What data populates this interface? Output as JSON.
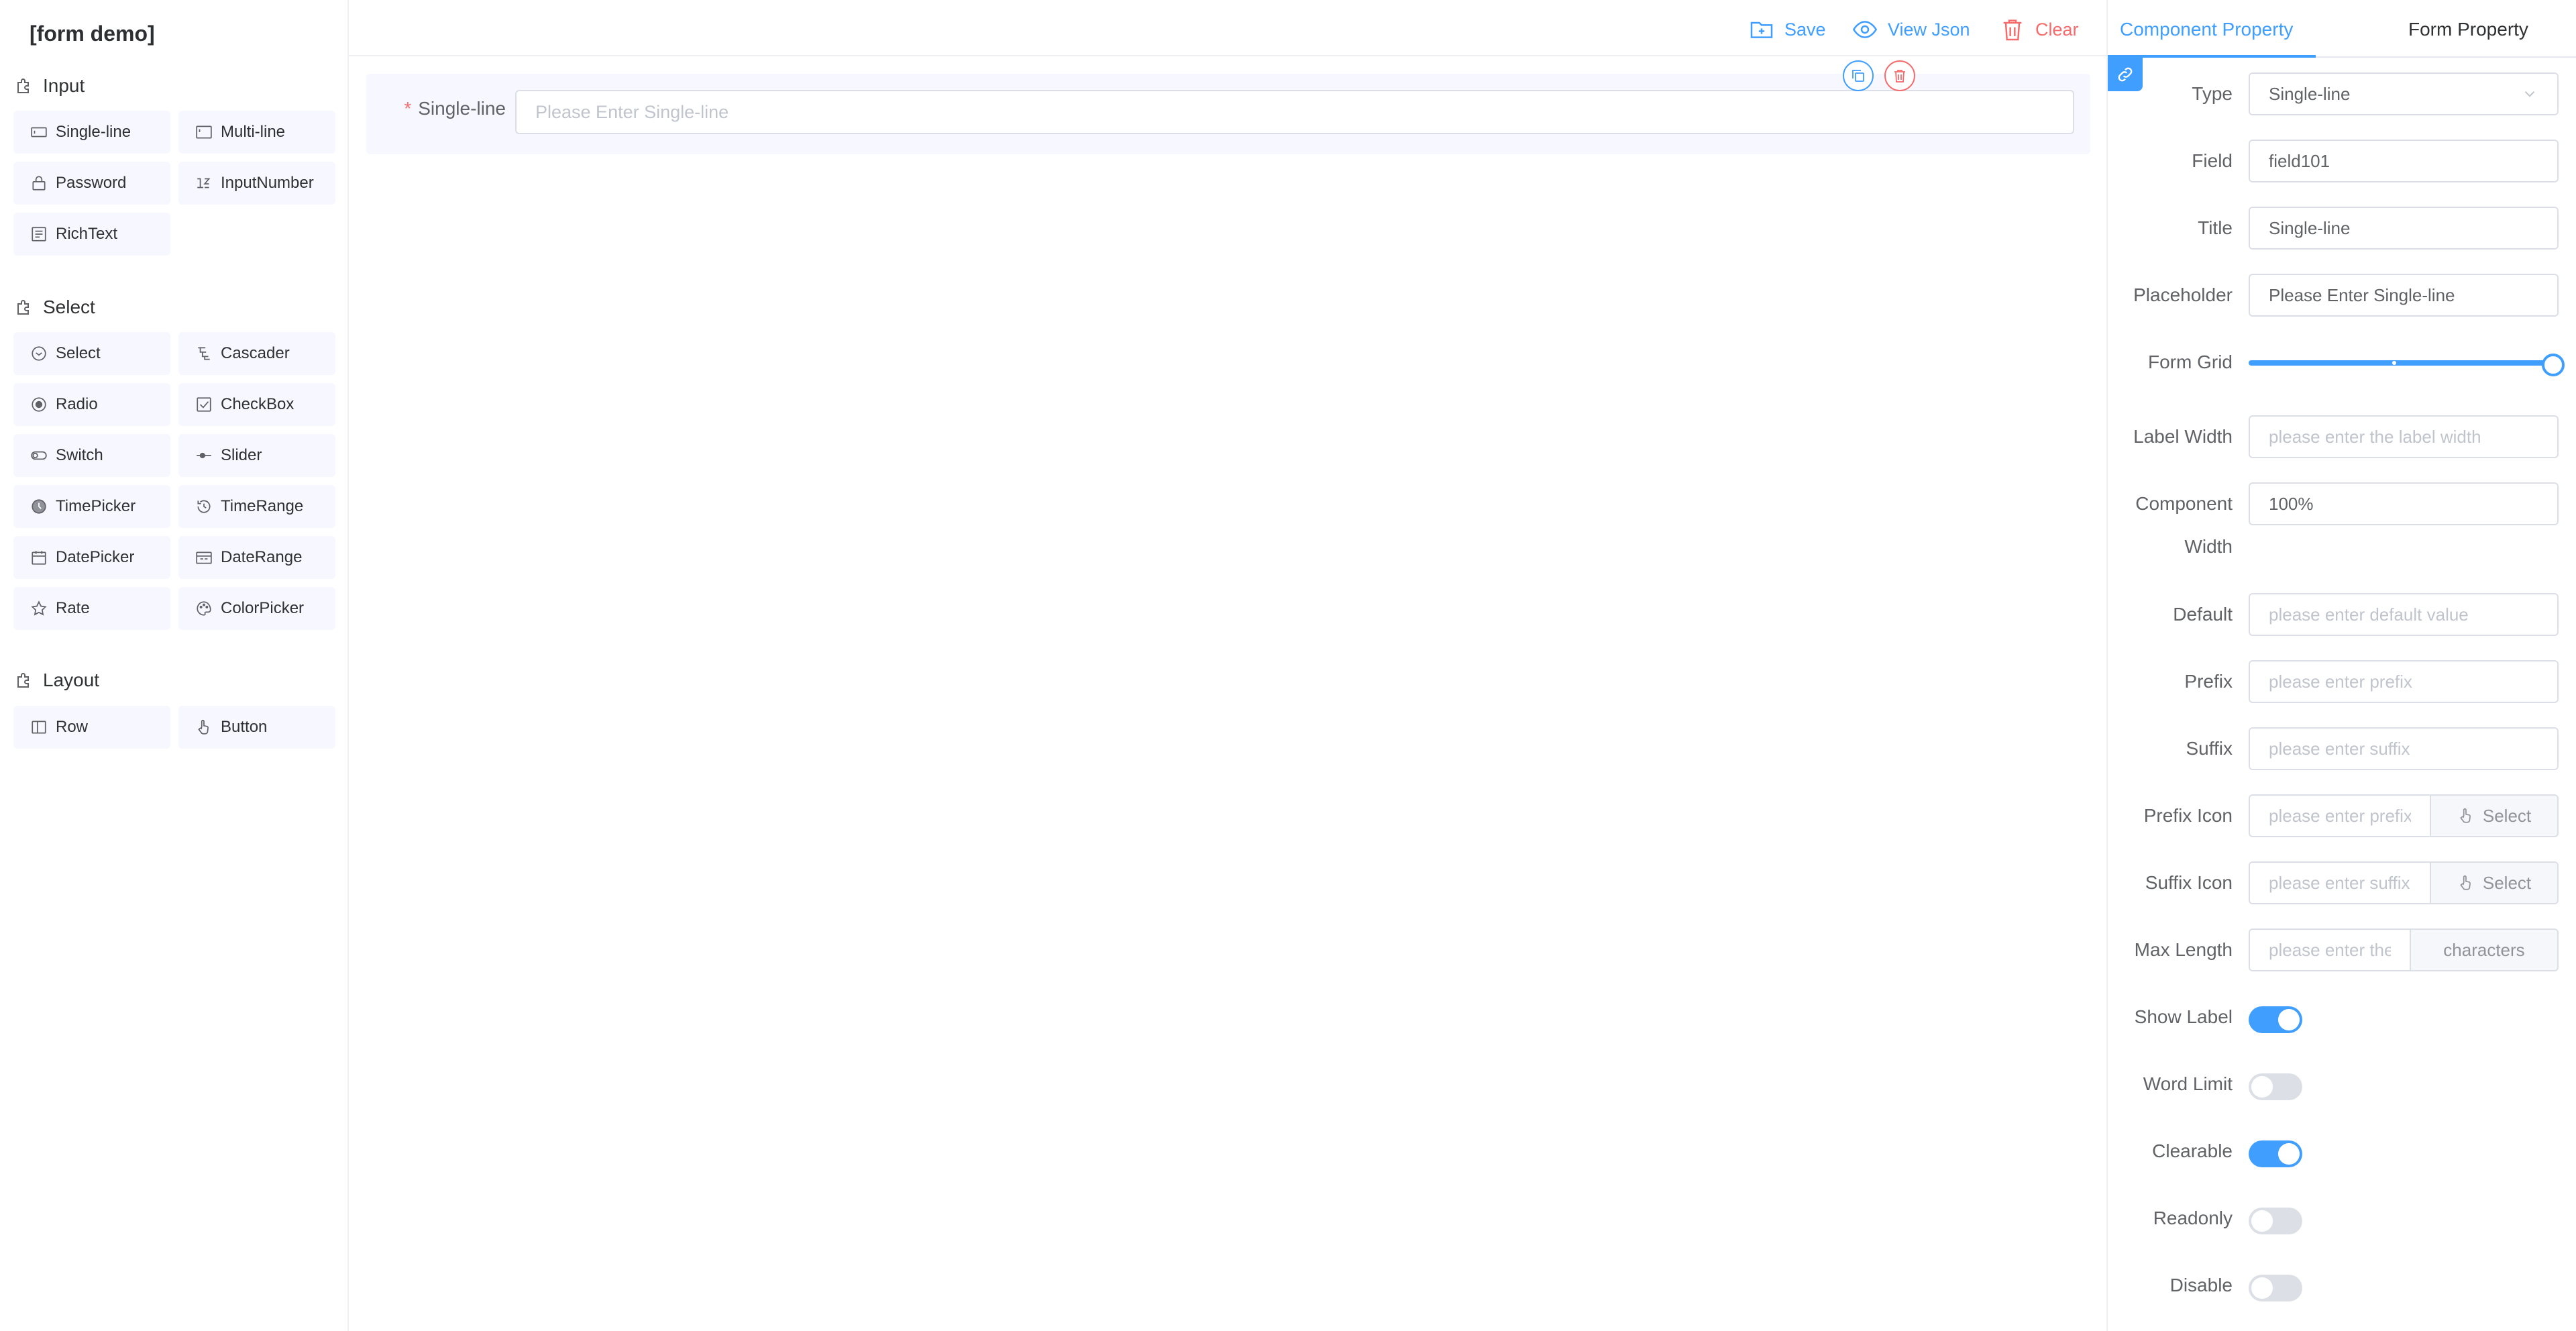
{
  "app": {
    "title": "[form demo]"
  },
  "toolbar": {
    "save_label": "Save",
    "view_json_label": "View Json",
    "clear_label": "Clear"
  },
  "sidebar": {
    "groups": [
      {
        "title": "Input",
        "items": [
          {
            "label": "Single-line",
            "icon": "input-icon"
          },
          {
            "label": "Multi-line",
            "icon": "textarea-icon"
          },
          {
            "label": "Password",
            "icon": "lock-icon"
          },
          {
            "label": "InputNumber",
            "icon": "number-icon"
          },
          {
            "label": "RichText",
            "icon": "richtext-icon"
          }
        ]
      },
      {
        "title": "Select",
        "items": [
          {
            "label": "Select",
            "icon": "select-icon"
          },
          {
            "label": "Cascader",
            "icon": "cascader-icon"
          },
          {
            "label": "Radio",
            "icon": "radio-icon"
          },
          {
            "label": "CheckBox",
            "icon": "checkbox-icon"
          },
          {
            "label": "Switch",
            "icon": "switch-icon"
          },
          {
            "label": "Slider",
            "icon": "slider-icon"
          },
          {
            "label": "TimePicker",
            "icon": "clock-icon"
          },
          {
            "label": "TimeRange",
            "icon": "time-range-icon"
          },
          {
            "label": "DatePicker",
            "icon": "calendar-icon"
          },
          {
            "label": "DateRange",
            "icon": "date-range-icon"
          },
          {
            "label": "Rate",
            "icon": "star-icon"
          },
          {
            "label": "ColorPicker",
            "icon": "palette-icon"
          }
        ]
      },
      {
        "title": "Layout",
        "items": [
          {
            "label": "Row",
            "icon": "row-icon"
          },
          {
            "label": "Button",
            "icon": "pointer-icon"
          }
        ]
      }
    ]
  },
  "canvas": {
    "item": {
      "label": "Single-line",
      "required_mark": "*",
      "placeholder": "Please Enter Single-line"
    }
  },
  "right_panel": {
    "tabs": {
      "component": "Component Property",
      "form": "Form Property"
    },
    "properties": {
      "type": {
        "label": "Type",
        "value": "Single-line"
      },
      "field": {
        "label": "Field",
        "value": "field101"
      },
      "title": {
        "label": "Title",
        "value": "Single-line"
      },
      "placeholder": {
        "label": "Placeholder",
        "value": "Please Enter Single-line"
      },
      "form_grid": {
        "label": "Form Grid",
        "value": 24,
        "max": 24
      },
      "label_width": {
        "label": "Label Width",
        "placeholder": "please enter the label width"
      },
      "component_width": {
        "label": "Component Width",
        "value": "100%"
      },
      "default": {
        "label": "Default",
        "placeholder": "please enter default value"
      },
      "prefix": {
        "label": "Prefix",
        "placeholder": "please enter prefix"
      },
      "suffix": {
        "label": "Suffix",
        "placeholder": "please enter suffix"
      },
      "prefix_icon": {
        "label": "Prefix Icon",
        "placeholder": "please enter prefix icon",
        "button": "Select"
      },
      "suffix_icon": {
        "label": "Suffix Icon",
        "placeholder": "please enter suffix icon",
        "button": "Select"
      },
      "max_length": {
        "label": "Max Length",
        "placeholder": "please enter the max length",
        "append": "characters"
      },
      "show_label": {
        "label": "Show Label",
        "on": true
      },
      "word_limit": {
        "label": "Word Limit",
        "on": false
      },
      "clearable": {
        "label": "Clearable",
        "on": true
      },
      "readonly": {
        "label": "Readonly",
        "on": false
      },
      "disable": {
        "label": "Disable",
        "on": false
      }
    }
  },
  "colors": {
    "primary": "#409eff",
    "danger": "#f56c6c",
    "item_bg": "#f6f7ff",
    "border": "#dcdfe6"
  }
}
